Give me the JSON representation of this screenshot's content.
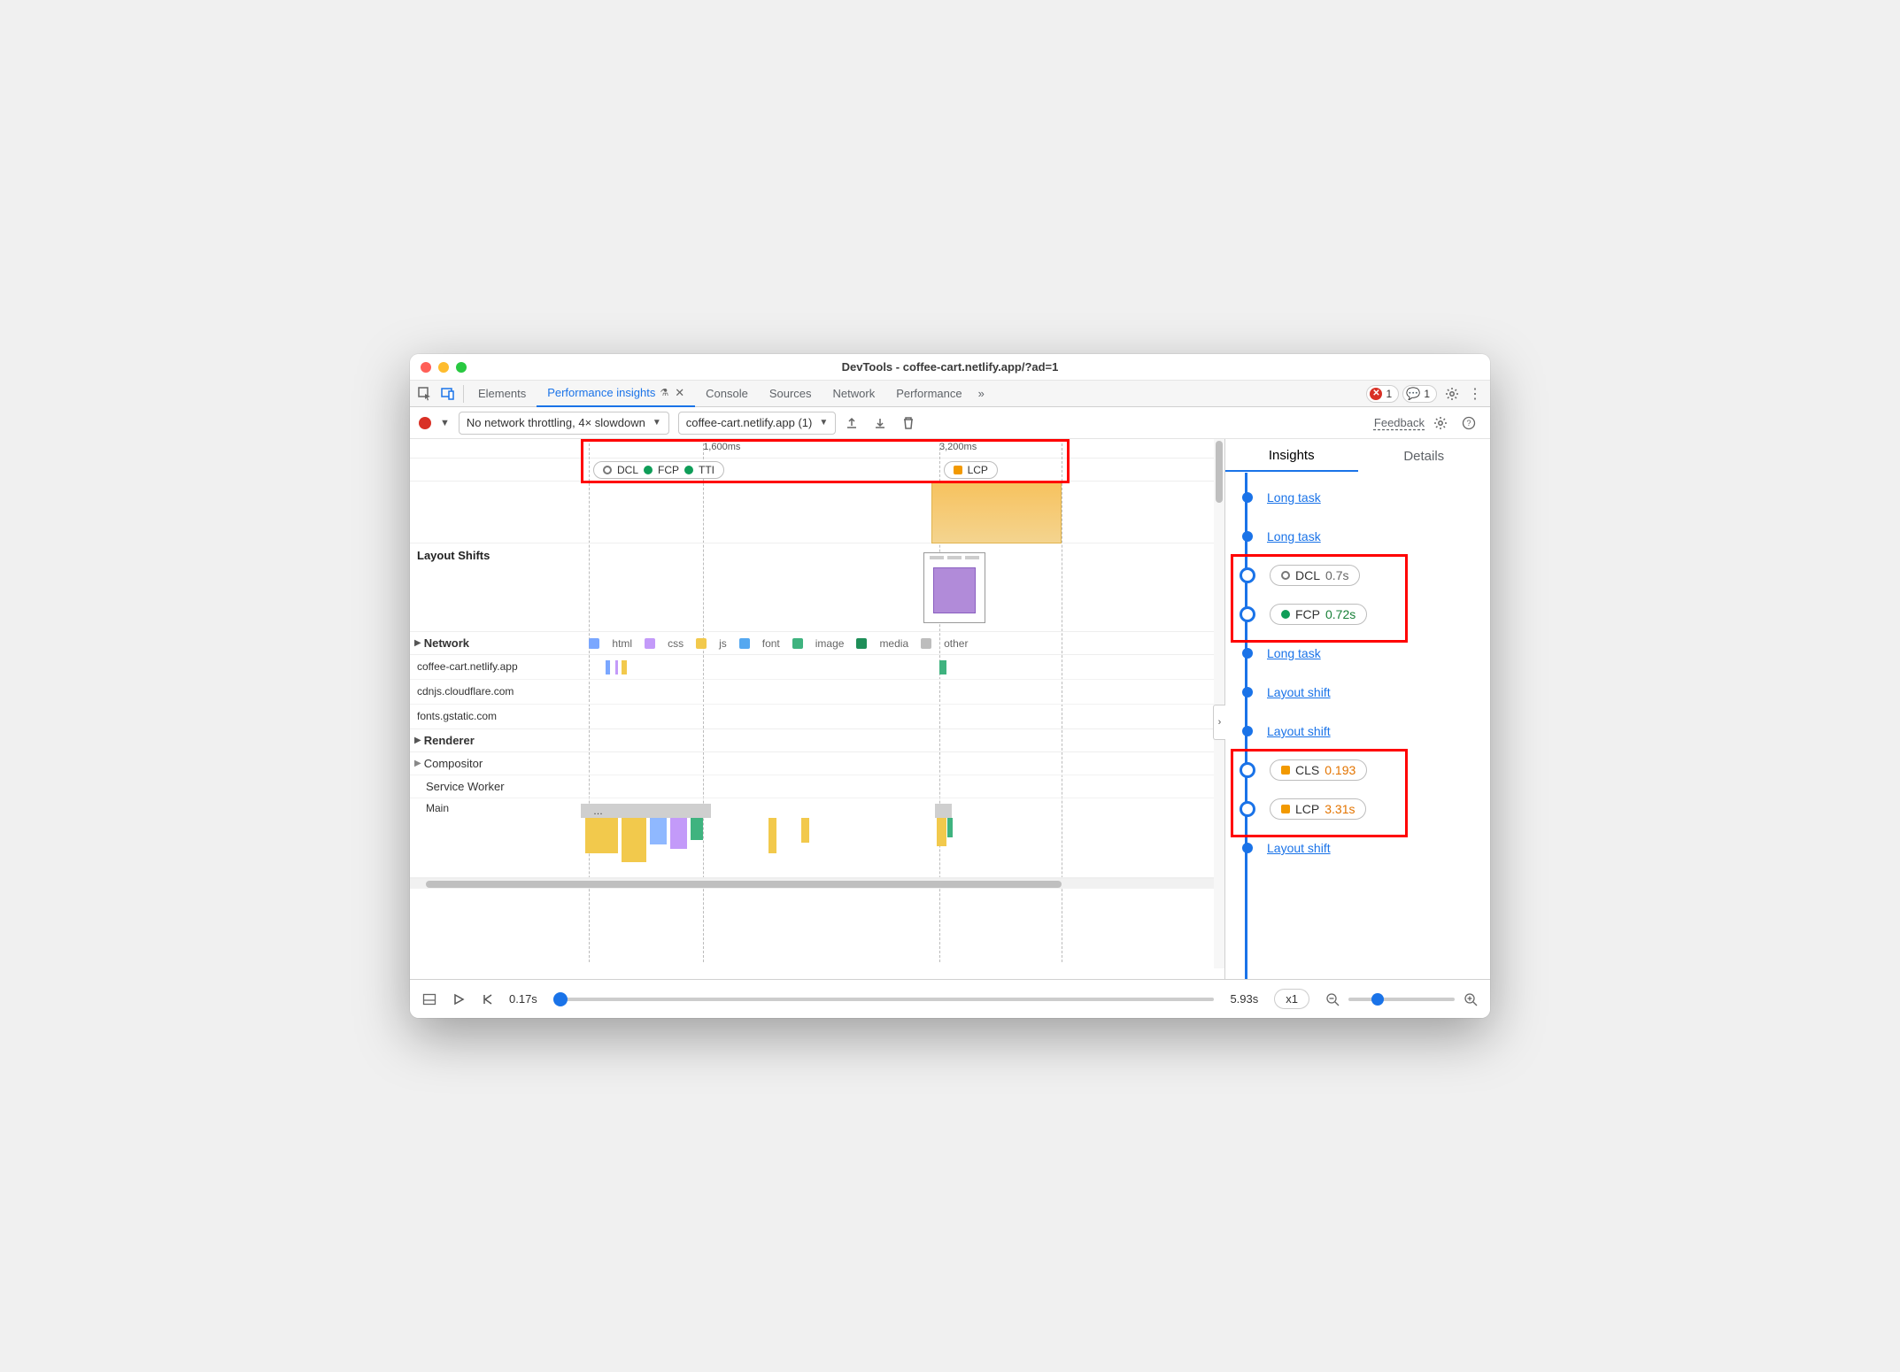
{
  "window": {
    "title": "DevTools - coffee-cart.netlify.app/?ad=1"
  },
  "tabs": {
    "items": [
      "Elements",
      "Performance insights",
      "Console",
      "Sources",
      "Network",
      "Performance"
    ],
    "active_index": 1,
    "overflow_glyph": "»",
    "error_count": "1",
    "message_count": "1"
  },
  "subtoolbar": {
    "throttling": "No network throttling, 4× slowdown",
    "page_select": "coffee-cart.netlify.app (1)",
    "feedback": "Feedback"
  },
  "ruler": {
    "ticks": [
      {
        "label": "1,600ms",
        "left_pct": 36
      },
      {
        "label": "3,200ms",
        "left_pct": 65
      }
    ]
  },
  "markers": {
    "group_a": [
      {
        "kind": "ring",
        "label": "DCL"
      },
      {
        "kind": "dot-green",
        "label": "FCP"
      },
      {
        "kind": "dot-green",
        "label": "TTI"
      }
    ],
    "group_b": [
      {
        "kind": "sq-orange",
        "label": "LCP"
      }
    ]
  },
  "sections": {
    "layout_shifts": "Layout Shifts",
    "network": "Network",
    "renderer": "Renderer",
    "compositor": "Compositor",
    "service_worker": "Service Worker",
    "main": "Main"
  },
  "legend": [
    {
      "color": "#7aa7ff",
      "label": "html"
    },
    {
      "color": "#c39af9",
      "label": "css"
    },
    {
      "color": "#f2c94c",
      "label": "js"
    },
    {
      "color": "#55a8f0",
      "label": "font"
    },
    {
      "color": "#3fb37f",
      "label": "image"
    },
    {
      "color": "#1e8e58",
      "label": "media"
    },
    {
      "color": "#bdbdbd",
      "label": "other"
    }
  ],
  "network_rows": [
    "coffee-cart.netlify.app",
    "cdnjs.cloudflare.com",
    "fonts.gstatic.com"
  ],
  "insights": {
    "tabs": {
      "a": "Insights",
      "b": "Details"
    },
    "items": [
      {
        "type": "link",
        "label": "Long task"
      },
      {
        "type": "link",
        "label": "Long task"
      },
      {
        "type": "metric",
        "icon": "ring",
        "name": "DCL",
        "value": "0.7s",
        "value_class": "gray"
      },
      {
        "type": "metric",
        "icon": "dot-green",
        "name": "FCP",
        "value": "0.72s",
        "value_class": "green"
      },
      {
        "type": "link",
        "label": "Long task"
      },
      {
        "type": "link",
        "label": "Layout shift"
      },
      {
        "type": "link",
        "label": "Layout shift"
      },
      {
        "type": "metric",
        "icon": "sq-orange",
        "name": "CLS",
        "value": "0.193",
        "value_class": "orange"
      },
      {
        "type": "metric",
        "icon": "sq-orange",
        "name": "LCP",
        "value": "3.31s",
        "value_class": "orange"
      },
      {
        "type": "link",
        "label": "Layout shift"
      }
    ]
  },
  "footer": {
    "start": "0.17s",
    "end": "5.93s",
    "speed": "x1"
  }
}
